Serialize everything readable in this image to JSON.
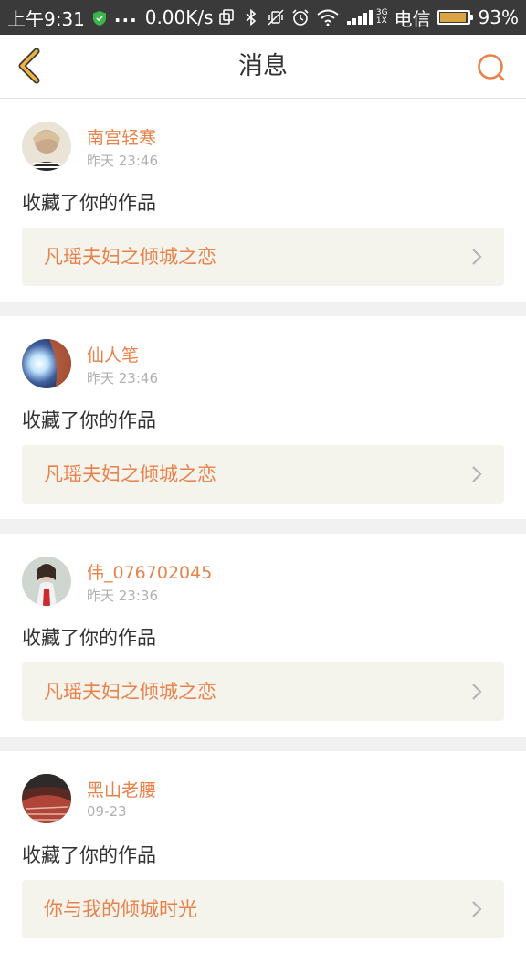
{
  "status_bar": {
    "time": "上午9:31",
    "dots": "...",
    "speed": "0.00K/s",
    "net_top": "3G",
    "net_bottom": "1X",
    "carrier": "电信",
    "battery_percent": "93%",
    "battery_level": 0.93
  },
  "header": {
    "title": "消息",
    "back_icon": "chevron-left-icon",
    "search_icon": "search-icon"
  },
  "colors": {
    "accent": "#e8824a",
    "back_arrow": "#f2b33d"
  },
  "messages": [
    {
      "name": "南宫轻寒",
      "time": "昨天 23:46",
      "action": "收藏了你的作品",
      "work": "凡瑶夫妇之倾城之恋"
    },
    {
      "name": "仙人笔",
      "time": "昨天 23:46",
      "action": "收藏了你的作品",
      "work": "凡瑶夫妇之倾城之恋"
    },
    {
      "name": "伟_076702045",
      "time": "昨天 23:36",
      "action": "收藏了你的作品",
      "work": "凡瑶夫妇之倾城之恋"
    },
    {
      "name": "黑山老腰",
      "time": "09-23",
      "action": "收藏了你的作品",
      "work": "你与我的倾城时光"
    }
  ]
}
